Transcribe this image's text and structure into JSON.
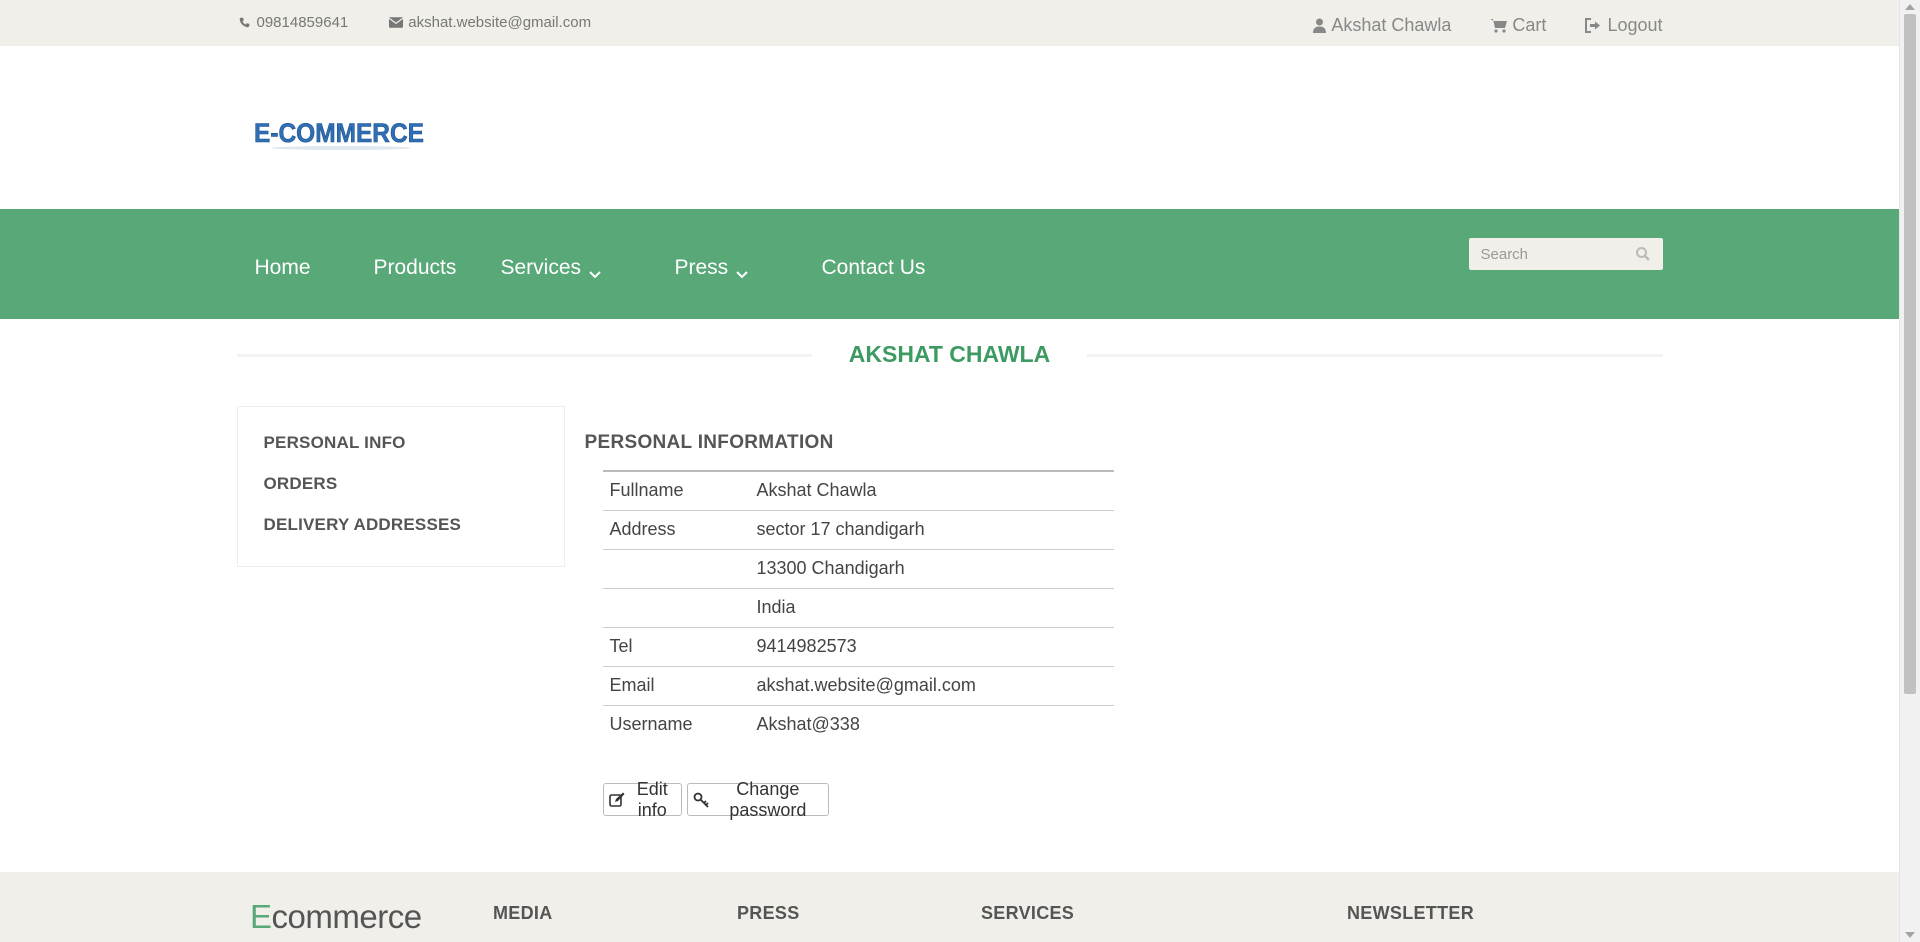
{
  "topbar": {
    "phone": "09814859641",
    "email": "akshat.website@gmail.com",
    "user": "Akshat Chawla",
    "cart": "Cart",
    "logout": "Logout"
  },
  "logo": {
    "text": "E-COMMERCE"
  },
  "nav": {
    "home": "Home",
    "products": "Products",
    "services": "Services",
    "press": "Press",
    "contact": "Contact Us",
    "search_placeholder": "Search"
  },
  "page": {
    "title": "AKSHAT CHAWLA"
  },
  "sidebar": {
    "items": [
      {
        "label": "PERSONAL INFO"
      },
      {
        "label": "ORDERS"
      },
      {
        "label": "DELIVERY ADDRESSES"
      }
    ]
  },
  "info": {
    "heading": "PERSONAL INFORMATION",
    "rows": [
      {
        "label": "Fullname",
        "value": "Akshat Chawla"
      },
      {
        "label": "Address",
        "value": "sector 17 chandigarh"
      },
      {
        "label": "",
        "value": "13300 Chandigarh"
      },
      {
        "label": "",
        "value": "India"
      },
      {
        "label": "Tel",
        "value": "9414982573"
      },
      {
        "label": "Email",
        "value": "akshat.website@gmail.com"
      },
      {
        "label": "Username",
        "value": "Akshat@338"
      }
    ],
    "edit_label": "Edit info",
    "password_label": "Change password"
  },
  "footer": {
    "logo_first": "E",
    "logo_rest": "commerce",
    "columns": [
      "MEDIA",
      "PRESS",
      "SERVICES",
      "NEWSLETTER"
    ]
  },
  "colors": {
    "nav_bg": "#58a878",
    "title": "#3d9a62",
    "topbar_bg": "#f0efe9",
    "logo_blue": "#2f6fb5"
  }
}
